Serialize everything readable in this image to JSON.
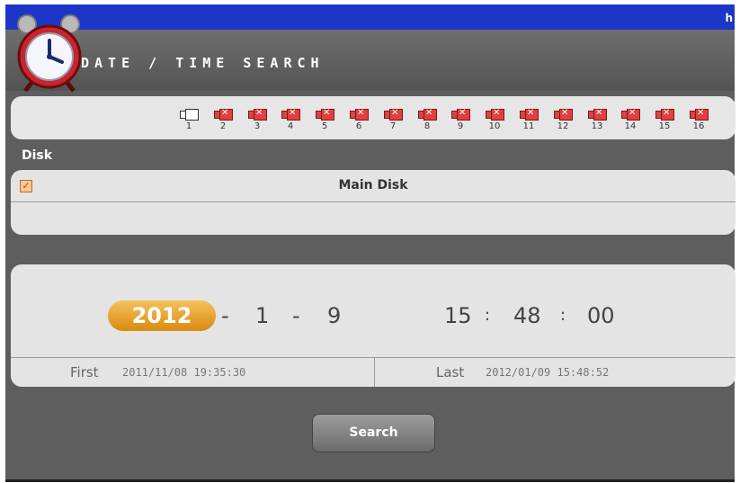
{
  "window": {
    "title": "DATE / TIME SEARCH",
    "corner_text": "h"
  },
  "channels": [
    {
      "label": "1",
      "state": "selected"
    },
    {
      "label": "2",
      "state": "no-signal"
    },
    {
      "label": "3",
      "state": "no-signal"
    },
    {
      "label": "4",
      "state": "no-signal"
    },
    {
      "label": "5",
      "state": "no-signal"
    },
    {
      "label": "6",
      "state": "no-signal"
    },
    {
      "label": "7",
      "state": "no-signal"
    },
    {
      "label": "8",
      "state": "no-signal"
    },
    {
      "label": "9",
      "state": "no-signal"
    },
    {
      "label": "10",
      "state": "no-signal"
    },
    {
      "label": "11",
      "state": "no-signal"
    },
    {
      "label": "12",
      "state": "no-signal"
    },
    {
      "label": "13",
      "state": "no-signal"
    },
    {
      "label": "14",
      "state": "no-signal"
    },
    {
      "label": "15",
      "state": "no-signal"
    },
    {
      "label": "16",
      "state": "no-signal"
    }
  ],
  "disk": {
    "label": "Disk",
    "items": [
      {
        "name": "Main Disk",
        "checked": true
      }
    ]
  },
  "datetime": {
    "year": "2012",
    "month": "1",
    "day": "9",
    "hour": "15",
    "minute": "48",
    "second": "00",
    "date_separator": "-",
    "time_separator": ":"
  },
  "range": {
    "first_label": "First",
    "first_value": "2011/11/08 19:35:30",
    "last_label": "Last",
    "last_value": "2012/01/09 15:48:52"
  },
  "search_button": "Search",
  "colors": {
    "title_bar": "#1c36c8",
    "window_bg": "#5e5e5e",
    "panel_bg": "#e4e4e4",
    "year_highlight": "#e8a530"
  },
  "icons": {
    "app": "alarm-clock-icon",
    "channel_on": "camera-icon",
    "channel_off": "camera-no-signal-icon"
  }
}
